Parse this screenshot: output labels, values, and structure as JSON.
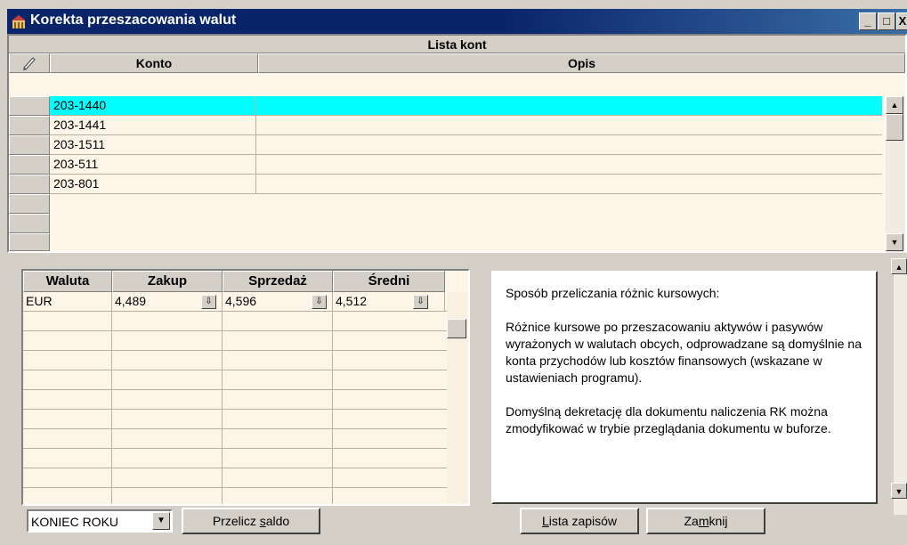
{
  "window": {
    "title": "Korekta przeszacowania walut",
    "min_label": "_",
    "max_label": "□",
    "close_label": "X"
  },
  "accounts": {
    "header": "Lista kont",
    "columns": {
      "konto": "Konto",
      "opis": "Opis"
    },
    "rows": [
      {
        "konto": "203-1440",
        "opis": "",
        "selected": true
      },
      {
        "konto": "203-1441",
        "opis": ""
      },
      {
        "konto": "203-1511",
        "opis": ""
      },
      {
        "konto": "203-511",
        "opis": ""
      },
      {
        "konto": "203-801",
        "opis": ""
      }
    ]
  },
  "currency": {
    "columns": {
      "waluta": "Waluta",
      "zakup": "Zakup",
      "sprzedaz": "Sprzedaż",
      "sredni": "Średni"
    },
    "rows": [
      {
        "waluta": "EUR",
        "zakup": "4,489",
        "sprzedaz": "4,596",
        "sredni": "4,512"
      }
    ]
  },
  "info": {
    "heading": "Sposób przeliczania różnic kursowych:",
    "para1": "Różnice kursowe po przeszacowaniu aktywów i pasywów wyrażonych w walutach obcych, odprowadzane są domyślnie na konta przychodów lub kosztów finansowych (wskazane w ustawieniach programu).",
    "para2": "Domyślną dekretację dla dokumentu naliczenia RK można zmodyfikować w trybie przeglądania dokumentu w buforze."
  },
  "controls": {
    "period_value": "KONIEC ROKU",
    "recalc_pre": "Przelicz ",
    "recalc_key": "s",
    "recalc_post": "aldo",
    "list_key": "L",
    "list_post": "ista zapisów",
    "close_pre": "Za",
    "close_key": "m",
    "close_post": "knij"
  },
  "colors": {
    "titlebar": "#0a246a",
    "selection": "#00ffff",
    "grid_bg": "#fdf6e8"
  }
}
